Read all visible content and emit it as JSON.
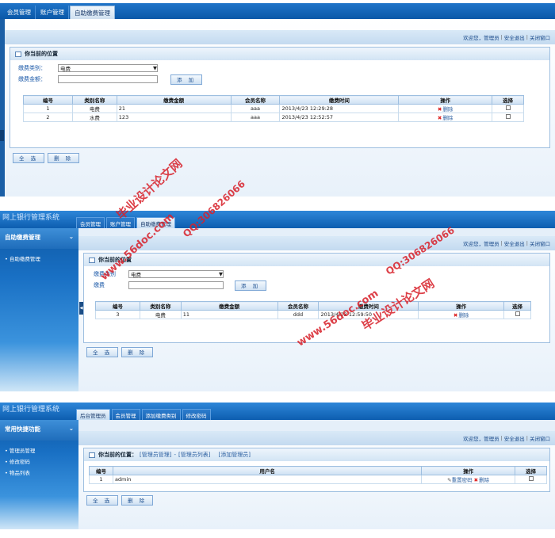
{
  "p1": {
    "tabs": [
      "会员管理",
      "账户管理",
      "自助缴费管理"
    ],
    "userbar": [
      "欢迎您，管理员",
      "安全退出",
      "关闭窗口"
    ],
    "location": "你当前的位置",
    "form": {
      "type_label": "缴费类别：",
      "type_value": "电费",
      "amount_label": "缴费金额：",
      "add_btn": "添 加"
    },
    "headers": [
      "编号",
      "类别名称",
      "缴费金额",
      "会员名称",
      "缴费时间",
      "操作",
      "选择"
    ],
    "rows": [
      {
        "id": "1",
        "cat": "电费",
        "amt": "21",
        "member": "aaa",
        "time": "2013/4/23 12:29:28",
        "op": "删除"
      },
      {
        "id": "2",
        "cat": "水费",
        "amt": "123",
        "member": "aaa",
        "time": "2013/4/23 12:52:57",
        "op": "删除"
      }
    ],
    "select_all": "全 选",
    "delete_btn": "删 除"
  },
  "p2": {
    "system": "网上银行管理系统",
    "tabs": [
      "会员管理",
      "账户管理",
      "自助缴费管理"
    ],
    "side_title": "自助缴费管理",
    "side_items": [
      "自助缴费管理"
    ],
    "userbar": [
      "欢迎您，管理员",
      "安全退出",
      "关闭窗口"
    ],
    "location": "你当前的位置",
    "form": {
      "type_label": "缴费类别",
      "type_value": "电费",
      "amount_label": "缴费",
      "add_btn": "添 加"
    },
    "headers": [
      "编号",
      "类别名称",
      "缴费金额",
      "会员名称",
      "缴费时间",
      "操作",
      "选择"
    ],
    "rows": [
      {
        "id": "3",
        "cat": "电费",
        "amt": "11",
        "member": "ddd",
        "time": "2013/4/23 12:59:50",
        "op": "删除"
      }
    ],
    "select_all": "全 选",
    "delete_btn": "删 除"
  },
  "p3": {
    "system": "网上银行管理系统",
    "tabs": [
      "后台管理员",
      "会员管理",
      "添加缴费类别",
      "修改密码"
    ],
    "side_title": "常用快捷功能",
    "side_items": [
      "管理员管理",
      "修改密码",
      "物品列表"
    ],
    "userbar": [
      "欢迎您，管理员",
      "安全退出",
      "关闭窗口"
    ],
    "location": "你当前的位置：",
    "crumbs": [
      "[管理员管理]",
      "-",
      "[管理员列表]",
      "[添加管理员]"
    ],
    "headers": [
      "编号",
      "用户名",
      "操作",
      "选择"
    ],
    "rows": [
      {
        "id": "1",
        "name": "admin",
        "reset": "重置密码",
        "op": "删除"
      }
    ],
    "select_all": "全 选",
    "delete_btn": "删 除"
  },
  "watermarks": [
    "毕业设计论文网",
    "www.56doc.com",
    "QQ:306826066",
    "www.56doc.com",
    "QQ:306826066",
    "毕业设计论文网"
  ],
  "colors": {
    "accent": "#0d5eb0",
    "watermark": "#d8202a",
    "label": "#1a58a8"
  }
}
